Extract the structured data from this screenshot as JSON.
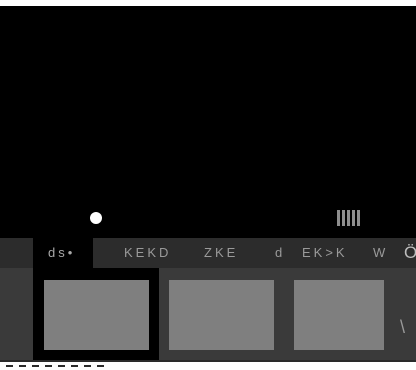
{
  "tabs": [
    {
      "label": "ds•",
      "active": true
    },
    {
      "label": "KEKD",
      "active": false
    },
    {
      "label": "ZKE",
      "active": false
    },
    {
      "label": "d",
      "active": false
    },
    {
      "label": "EK>K",
      "active": false
    },
    {
      "label": "W",
      "active": false
    }
  ],
  "tab_overflow_label": "Ö",
  "edge_glyph": "\\",
  "tiles": [
    "tile-1",
    "tile-2",
    "tile-3"
  ],
  "colors": {
    "background": "#000000",
    "tab_bar": "#2c2c2c",
    "tile_row": "#3a3a3a",
    "tile": "#7f7f7f",
    "indicator_dot": "#ffffff"
  }
}
